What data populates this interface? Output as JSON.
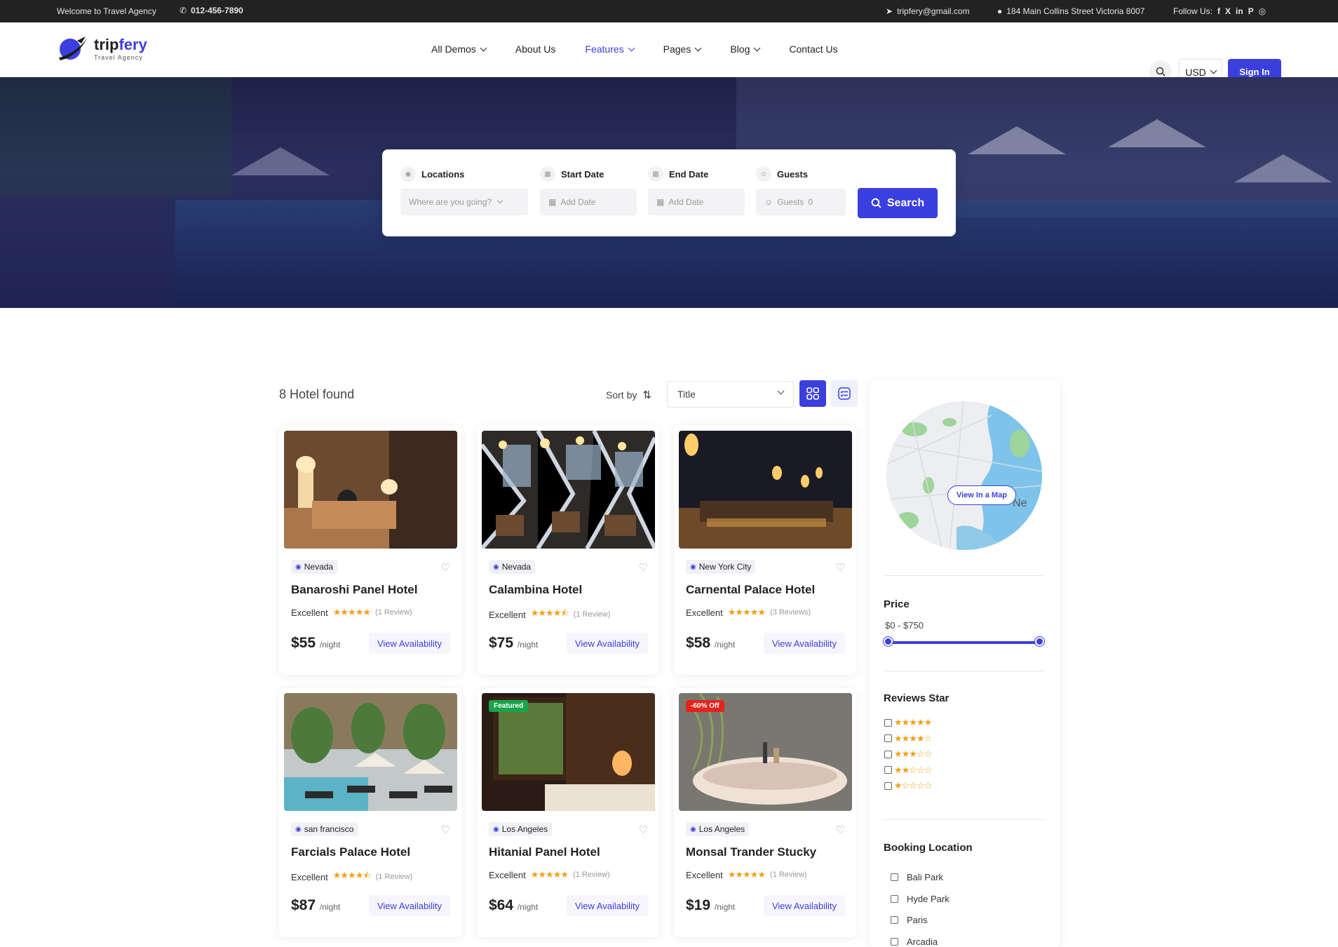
{
  "topbar": {
    "welcome": "Welcome to Travel Agency",
    "phone": "012-456-7890",
    "email": "tripfery@gmail.com",
    "address": "184 Main Collins Street Victoria 8007",
    "follow_label": "Follow Us:",
    "socials": [
      "f",
      "X",
      "in",
      "P",
      "◎"
    ]
  },
  "brand": {
    "name_a": "trip",
    "name_b": "fery",
    "tagline": "Travel Agency"
  },
  "nav": [
    {
      "label": "All Demos",
      "has_dropdown": true,
      "active": false
    },
    {
      "label": "About Us",
      "has_dropdown": false,
      "active": false
    },
    {
      "label": "Features",
      "has_dropdown": true,
      "active": true
    },
    {
      "label": "Pages",
      "has_dropdown": true,
      "active": false
    },
    {
      "label": "Blog",
      "has_dropdown": true,
      "active": false
    },
    {
      "label": "Contact Us",
      "has_dropdown": false,
      "active": false
    }
  ],
  "header": {
    "currency": "USD",
    "signin": "Sign In"
  },
  "search": {
    "locations_label": "Locations",
    "locations_placeholder": "Where are you going?",
    "start_label": "Start Date",
    "start_placeholder": "Add Date",
    "end_label": "End Date",
    "end_placeholder": "Add Date",
    "guests_label": "Guests",
    "guests_placeholder": "Guests",
    "guests_value": "0",
    "button": "Search"
  },
  "results": {
    "count_text": "8 Hotel found",
    "sort_label": "Sort by",
    "sort_value": "Title"
  },
  "hotels": [
    {
      "location": "Nevada",
      "name": "Banaroshi Panel Hotel",
      "rating_word": "Excellent",
      "stars": 5,
      "reviews": "(1 Review)",
      "price": "$55",
      "unit": "/night",
      "cta": "View Availability",
      "badge": ""
    },
    {
      "location": "Nevada",
      "name": "Calambina Hotel",
      "rating_word": "Excellent",
      "stars": 4.5,
      "reviews": "(1 Review)",
      "price": "$75",
      "unit": "/night",
      "cta": "View Availability",
      "badge": ""
    },
    {
      "location": "New York City",
      "name": "Carnental Palace Hotel",
      "rating_word": "Excellent",
      "stars": 5,
      "reviews": "(3 Reviews)",
      "price": "$58",
      "unit": "/night",
      "cta": "View Availability",
      "badge": ""
    },
    {
      "location": "san francisco",
      "name": "Farcials Palace Hotel",
      "rating_word": "Excellent",
      "stars": 4.5,
      "reviews": "(1 Review)",
      "price": "$87",
      "unit": "/night",
      "cta": "View Availability",
      "badge": ""
    },
    {
      "location": "Los Angeles",
      "name": "Hitanial Panel Hotel",
      "rating_word": "Excellent",
      "stars": 5,
      "reviews": "(1 Review)",
      "price": "$64",
      "unit": "/night",
      "cta": "View Availability",
      "badge": "Featured"
    },
    {
      "location": "Los Angeles",
      "name": "Monsal Trander Stucky",
      "rating_word": "Excellent",
      "stars": 5,
      "reviews": "(1 Review)",
      "price": "$19",
      "unit": "/night",
      "cta": "View Availability",
      "badge": "-60% Off"
    }
  ],
  "sidebar": {
    "map_button": "View In a Map",
    "price_title": "Price",
    "price_range": "$0 - $750",
    "reviews_title": "Reviews Star",
    "star_filters": [
      5,
      4,
      3,
      2,
      1
    ],
    "location_title": "Booking Location",
    "locations": [
      "Bali Park",
      "Hyde Park",
      "Paris",
      "Arcadia"
    ]
  },
  "colors": {
    "accent": "#3b3fde",
    "star": "#f0a017",
    "featured": "#1aa34a",
    "sale": "#e3231c"
  }
}
